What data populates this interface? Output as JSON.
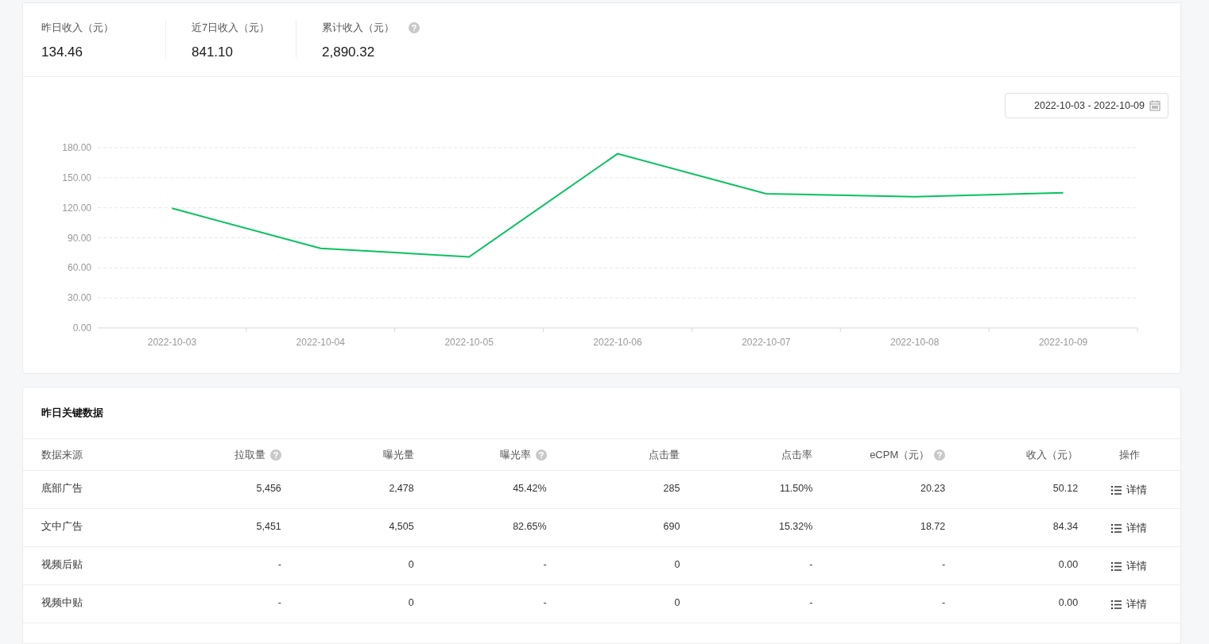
{
  "stats": [
    {
      "label": "昨日收入（元）",
      "value": "134.46",
      "help": false
    },
    {
      "label": "近7日收入（元）",
      "value": "841.10",
      "help": false
    },
    {
      "label": "累计收入（元）",
      "value": "2,890.32",
      "help": true
    }
  ],
  "date_range": "2022-10-03 - 2022-10-09",
  "chart_data": {
    "type": "line",
    "categories": [
      "2022-10-03",
      "2022-10-04",
      "2022-10-05",
      "2022-10-06",
      "2022-10-07",
      "2022-10-08",
      "2022-10-09"
    ],
    "ylim": [
      0,
      180
    ],
    "yticks": [
      {
        "value": 0,
        "label": "0.00"
      },
      {
        "value": 30,
        "label": "30.00"
      },
      {
        "value": 60,
        "label": "60.00"
      },
      {
        "value": 90,
        "label": "90.00"
      },
      {
        "value": 120,
        "label": "120.00"
      },
      {
        "value": 150,
        "label": "150.00"
      },
      {
        "value": 180,
        "label": "180.00"
      }
    ],
    "grid": true,
    "series": [
      {
        "color": "#07c160",
        "values": [
          119.5,
          79.5,
          71,
          174,
          134,
          131,
          135
        ]
      }
    ]
  },
  "table": {
    "title": "昨日关键数据",
    "columns": [
      {
        "label": "数据来源",
        "help": false
      },
      {
        "label": "拉取量",
        "help": true
      },
      {
        "label": "曝光量",
        "help": false
      },
      {
        "label": "曝光率",
        "help": true
      },
      {
        "label": "点击量",
        "help": false
      },
      {
        "label": "点击率",
        "help": false
      },
      {
        "label": "eCPM（元）",
        "help": true
      },
      {
        "label": "收入（元）",
        "help": false
      },
      {
        "label": "操作",
        "help": false
      }
    ],
    "rows": [
      {
        "cells": [
          "底部广告",
          "5,456",
          "2,478",
          "45.42%",
          "285",
          "11.50%",
          "20.23",
          "50.12"
        ],
        "action": "详情"
      },
      {
        "cells": [
          "文中广告",
          "5,451",
          "4,505",
          "82.65%",
          "690",
          "15.32%",
          "18.72",
          "84.34"
        ],
        "action": "详情"
      },
      {
        "cells": [
          "视频后贴",
          "-",
          "0",
          "-",
          "0",
          "-",
          "-",
          "0.00"
        ],
        "action": "详情"
      },
      {
        "cells": [
          "视频中贴",
          "-",
          "0",
          "-",
          "0",
          "-",
          "-",
          "0.00"
        ],
        "action": "详情"
      }
    ]
  }
}
